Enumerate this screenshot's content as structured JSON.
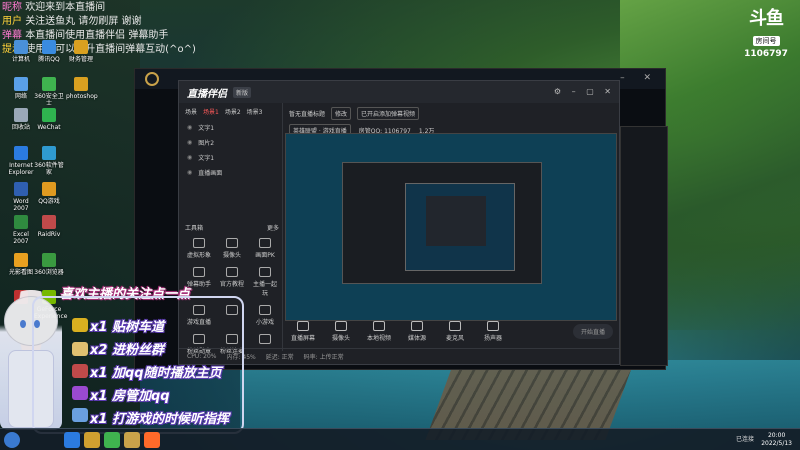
{
  "chat": [
    {
      "nick": "昵称",
      "text": "欢迎来到本直播间"
    },
    {
      "nick": "用户",
      "text": "关注送鱼丸 请勿刷屏 谢谢"
    },
    {
      "nick": "弹幕",
      "text": "本直播间使用直播伴侣 弹幕助手"
    },
    {
      "nick": "提示",
      "text": "使用我可以提升直播间弹幕互动(^o^)"
    }
  ],
  "desktop_icons": [
    {
      "label": "计算机",
      "color": "#4a90d9"
    },
    {
      "label": "网络",
      "color": "#5aa0e8"
    },
    {
      "label": "回收站",
      "color": "#9aa8b8"
    },
    {
      "label": "Internet Explorer",
      "color": "#2b7be0"
    },
    {
      "label": "Word 2007",
      "color": "#2f5fb0"
    },
    {
      "label": "Excel 2007",
      "color": "#2f8a3f"
    },
    {
      "label": "光影看图",
      "color": "#e8a020"
    },
    {
      "label": "",
      "color": "#c03030"
    },
    {
      "label": "腾讯QQ",
      "color": "#3a8be0"
    },
    {
      "label": "360安全卫士",
      "color": "#3fb34f"
    },
    {
      "label": "WeChat",
      "color": "#2fb34f"
    },
    {
      "label": "360软件管家",
      "color": "#2f9ad0"
    },
    {
      "label": "QQ游戏",
      "color": "#e09a20"
    },
    {
      "label": "RaidRiv",
      "color": "#c04a4a"
    },
    {
      "label": "360浏览器",
      "color": "#3a9a40"
    },
    {
      "label": "GeForce Experience",
      "color": "#76b900"
    },
    {
      "label": "财务管理",
      "color": "#d9a020"
    },
    {
      "label": "photoshop",
      "color": "#d9a020"
    }
  ],
  "room_badge": {
    "logo": "斗鱼",
    "label": "房间号",
    "number": "1106797"
  },
  "app": {
    "brand": "直播伴侣",
    "version": "新版",
    "scene_tabs": [
      "场景",
      "场景1",
      "场景2",
      "场景3"
    ],
    "sources": [
      "文字1",
      "图片2",
      "文字1",
      "直播画面"
    ],
    "tools_header": "工具箱",
    "tools_more": "更多",
    "tools": [
      [
        "虚拟形象",
        "摄像头",
        "画面PK"
      ],
      [
        "弹幕助手",
        "官方教程",
        "主播一起玩"
      ],
      [
        "游戏直播",
        "",
        "小游戏"
      ],
      [
        "粉丝勋章",
        "粉丝连麦",
        ""
      ]
    ],
    "top_bar": {
      "title": "暂无直播标题",
      "edit": "修改",
      "hint": "已开启添加弹幕视频",
      "category": "英雄联盟 · 游戏直播",
      "room": "房管QQ: 1106797",
      "stats": "1.2万"
    },
    "bottom_buttons": [
      "直播屏幕",
      "摄像头",
      "本地视频",
      "媒体源",
      "麦克风",
      "扬声器"
    ],
    "go_live": "开始直播",
    "status": [
      "CPU: 20%",
      "内存: 45%",
      "延迟: 正常",
      "码率: 上传正常"
    ]
  },
  "fan_panel": {
    "title": "喜欢主播的关注点一点",
    "lines": [
      "x1 贴树车道",
      "x2 进粉丝群",
      "x1 加qq随时播放主页",
      "x1 房管加qq",
      "x1 打游戏的时候听指挥"
    ]
  },
  "taskbar": {
    "time": "20:00",
    "date": "2022/5/13",
    "tray": "已连接"
  }
}
